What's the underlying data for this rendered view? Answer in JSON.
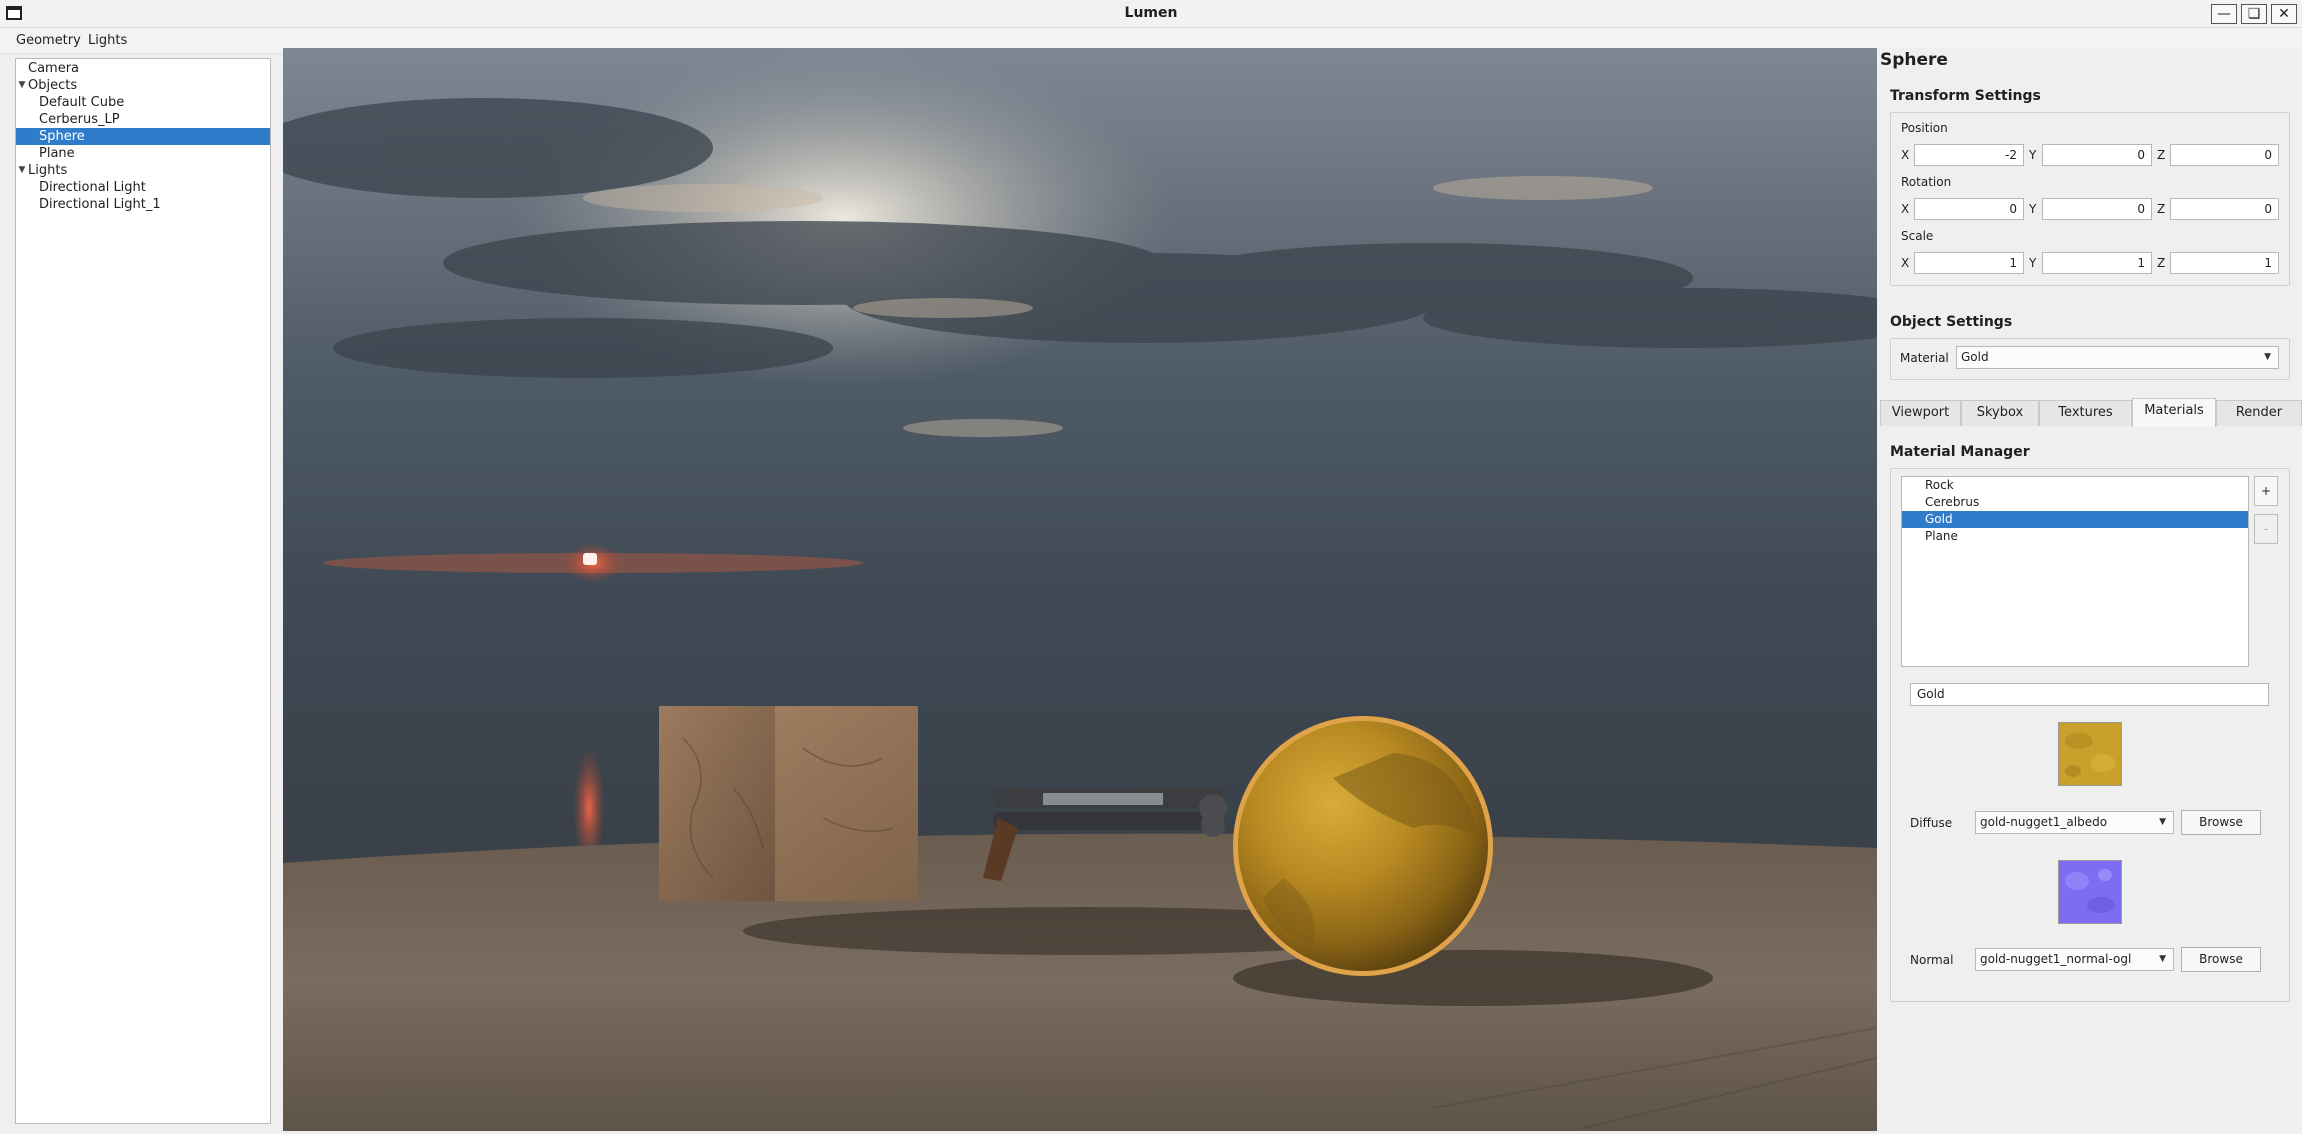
{
  "window": {
    "title": "Lumen"
  },
  "menu": [
    "Geometry",
    "Lights"
  ],
  "tree": [
    {
      "label": "Camera",
      "indent": 0,
      "arrow": false
    },
    {
      "label": "Objects",
      "indent": 0,
      "arrow": true
    },
    {
      "label": "Default Cube",
      "indent": 1,
      "arrow": false
    },
    {
      "label": "Cerberus_LP",
      "indent": 1,
      "arrow": false
    },
    {
      "label": "Sphere",
      "indent": 1,
      "arrow": false,
      "selected": true
    },
    {
      "label": "Plane",
      "indent": 1,
      "arrow": false
    },
    {
      "label": "Lights",
      "indent": 0,
      "arrow": true
    },
    {
      "label": "Directional Light",
      "indent": 1,
      "arrow": false
    },
    {
      "label": "Directional Light_1",
      "indent": 1,
      "arrow": false
    }
  ],
  "panel": {
    "title": "Sphere",
    "transform": {
      "heading": "Transform Settings",
      "position": {
        "label": "Position",
        "x": "-2",
        "y": "0",
        "z": "0"
      },
      "rotation": {
        "label": "Rotation",
        "x": "0",
        "y": "0",
        "z": "0"
      },
      "scale": {
        "label": "Scale",
        "x": "1",
        "y": "1",
        "z": "1"
      },
      "axis_x": "X",
      "axis_y": "Y",
      "axis_z": "Z"
    },
    "object": {
      "heading": "Object Settings",
      "material_label": "Material",
      "material_value": "Gold"
    },
    "tabs": [
      {
        "label": "Viewport"
      },
      {
        "label": "Skybox"
      },
      {
        "label": "Textures"
      },
      {
        "label": "Materials",
        "active": true
      },
      {
        "label": "Render"
      }
    ],
    "materials": {
      "heading": "Material Manager",
      "items": [
        "Rock",
        "Cerebrus",
        "Gold",
        "Plane"
      ],
      "selected_index": 2,
      "add_label": "+",
      "remove_label": "-",
      "name_value": "Gold",
      "diffuse": {
        "label": "Diffuse",
        "value": "gold-nugget1_albedo",
        "button": "Browse",
        "swatch_color": "#c9a02c"
      },
      "normal": {
        "label": "Normal",
        "value": "gold-nugget1_normal-ogl",
        "button": "Browse",
        "swatch_color": "#7d6df2"
      }
    }
  },
  "colors": {
    "accent": "#2f7dca"
  }
}
